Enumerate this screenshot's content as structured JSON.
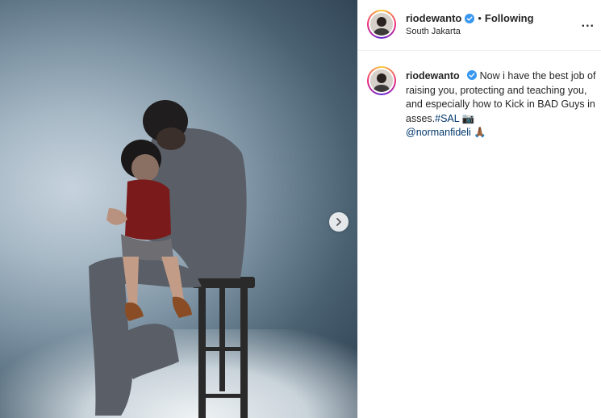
{
  "post": {
    "image_alt": "Father sitting on a stool holding his daughter on his lap in a studio",
    "next_icon": "chevron-right-icon"
  },
  "header": {
    "username": "riodewanto",
    "separator": "•",
    "follow_status": "Following",
    "location": "South Jakarta",
    "more_label": "...",
    "verified_icon": "verified-badge-icon"
  },
  "caption": {
    "username": "riodewanto",
    "text": "Now i have the best job of raising you, protecting and teaching you, and especially how to Kick in BAD Guys in asses.",
    "hashtag": "#SAL",
    "camera_emoji": "📷",
    "mention": "@normanfideli",
    "pray_emoji": "🙏🏾"
  },
  "colors": {
    "link": "#00376b",
    "verified": "#3897f0",
    "text": "#262626"
  }
}
